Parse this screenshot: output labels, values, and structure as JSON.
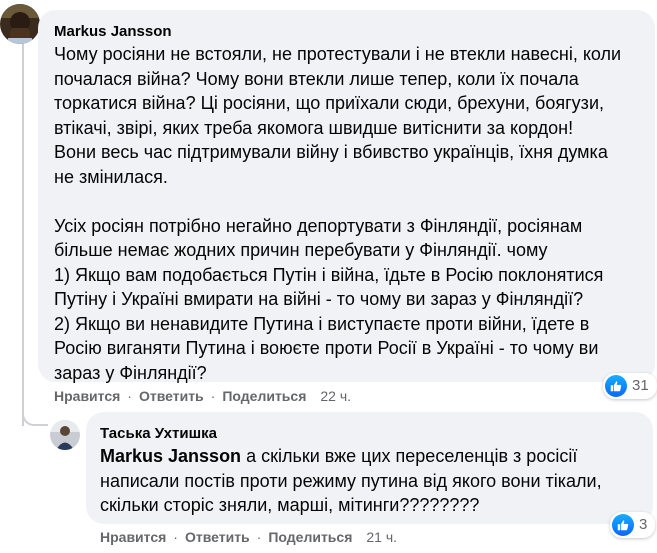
{
  "comments": [
    {
      "author": "Markus Jansson",
      "text": "Чому росіяни не встояли, не протестували і не втекли навесні, коли\nпочалася війна? Чому вони втекли лише тепер, коли їх почала\nторкатися війна? Ці росіяни, що приїхали сюди, брехуни, боягузи,\nвтікачі, звірі, яких треба якомога швидше витіснити за кордон!\nВони весь час підтримували війну і вбивство українців, їхня думка\nне змінилася.\n\nУсіх росіян потрібно негайно депортувати з Фінляндії, росіянам\nбільше немає жодних причин перебувати у Фінляндії. чому\n1) Якщо вам подобається Путін і війна, їдьте в Росію поклонятися\nПутіну і Україні вмирати на війні - то чому ви зараз у Фінляндії?\n2) Якщо ви ненавидите Путина і виступаєте проти війни, їдете в\nРосію виганяти Путина і воюєте проти Росії в Україні - то чому ви\nзараз у Фінляндії?",
      "actions": {
        "like": "Нравится",
        "reply": "Ответить",
        "share": "Поделиться"
      },
      "time": "22 ч.",
      "reactions": {
        "icon": "like-icon",
        "count": "31",
        "color": "#0866ff"
      }
    },
    {
      "author": "Таська Ухтишка",
      "mention": "Markus Jansson",
      "text": " а скільки вже цих переселенців з росісії\nнаписали постів проти режиму путина від якого вони тікали,\nскільки сторіс зняли, марші, мітинги????????",
      "actions": {
        "like": "Нравится",
        "reply": "Ответить",
        "share": "Поделиться"
      },
      "time": "21 ч.",
      "reactions": {
        "icon": "like-icon",
        "count": "3",
        "color": "#0866ff"
      }
    }
  ],
  "separator": "·",
  "colors": {
    "bubble": "#f0f2f5",
    "muted": "#65676b",
    "text": "#050505",
    "thread_line": "#ced0d4"
  }
}
